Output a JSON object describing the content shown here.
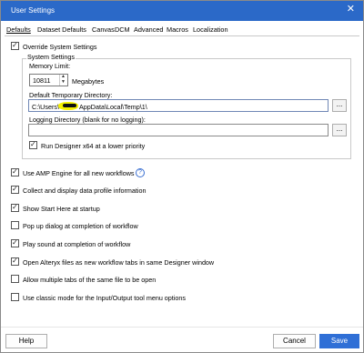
{
  "window": {
    "title": "User Settings",
    "close_glyph": "✕"
  },
  "tabs": [
    {
      "label": "Defaults",
      "active": true
    },
    {
      "label": "Dataset Defaults"
    },
    {
      "label": "Canvas"
    },
    {
      "label": "DCM"
    },
    {
      "label": "Advanced"
    },
    {
      "label": "Macros"
    },
    {
      "label": "Localization"
    }
  ],
  "override": {
    "label": "Override System Settings",
    "checked": true
  },
  "system_settings": {
    "legend": "System Settings",
    "memory_label": "Memory Limit:",
    "memory_value": "10811",
    "memory_unit": "Megabytes",
    "temp_dir_label": "Default Temporary Directory:",
    "temp_dir_value": "C:\\Users\\",
    "temp_dir_value_tail": "AppData\\Local\\Temp\\1\\",
    "logging_label": "Logging Directory (blank for no logging):",
    "logging_value": "",
    "browse_label": "...",
    "low_priority_label": "Run Designer x64 at a lower priority",
    "low_priority_checked": true
  },
  "options": [
    {
      "label": "Use AMP Engine for all new workflows",
      "checked": true
    },
    {
      "label": "Collect and display data profile information",
      "checked": true
    },
    {
      "label": "Show Start Here at startup",
      "checked": true
    },
    {
      "label": "Pop up dialog at completion of workflow",
      "checked": false
    },
    {
      "label": "Play sound at completion of workflow",
      "checked": true
    },
    {
      "label": "Open Alteryx files as new workflow tabs in same Designer window",
      "checked": true
    },
    {
      "label": "Allow multiple tabs of the same file to be open",
      "checked": false
    },
    {
      "label": "Use classic mode for the Input/Output tool menu options",
      "checked": false
    }
  ],
  "help_glyph": "?",
  "buttons": {
    "help": "Help",
    "cancel": "Cancel",
    "save": "Save"
  },
  "colors": {
    "titlebar": "#2b69c8",
    "primary_button": "#2f6fd6",
    "highlight": "#f5f000"
  }
}
